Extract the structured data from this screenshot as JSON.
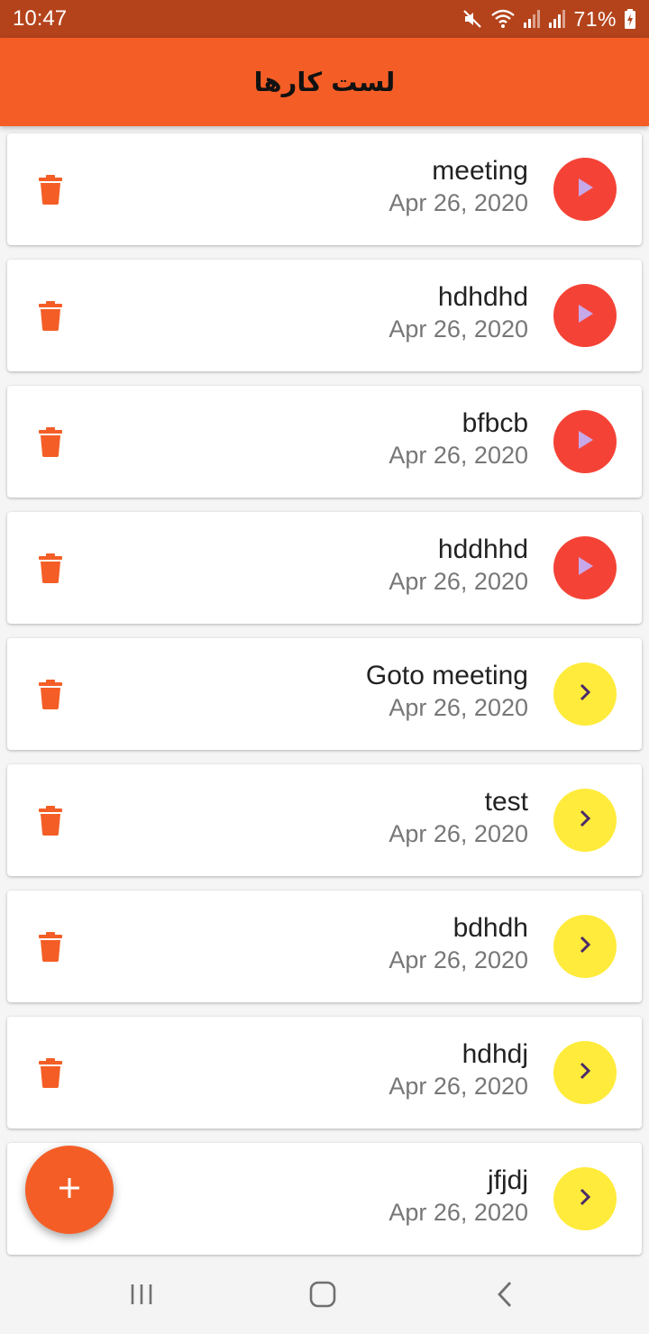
{
  "status_bar": {
    "time": "10:47",
    "battery": "71%",
    "icons": [
      "mute-icon",
      "wifi-icon",
      "signal-icon",
      "signal-icon",
      "battery-charging-icon"
    ]
  },
  "app_bar": {
    "title": "لست کارها"
  },
  "colors": {
    "status_bar": "#b4431b",
    "primary": "#f45e26",
    "play_button": "#f44336",
    "play_icon": "#c7a8e8",
    "next_button": "#ffeb3b",
    "next_icon": "#4a2a6a",
    "delete_icon": "#f45e26"
  },
  "tasks": [
    {
      "title": "meeting",
      "date": "Apr 26, 2020",
      "action": "play",
      "action_icon": "play-icon",
      "delete_icon": "trash-icon"
    },
    {
      "title": "hdhdhd",
      "date": "Apr 26, 2020",
      "action": "play",
      "action_icon": "play-icon",
      "delete_icon": "trash-icon"
    },
    {
      "title": "bfbcb",
      "date": "Apr 26, 2020",
      "action": "play",
      "action_icon": "play-icon",
      "delete_icon": "trash-icon"
    },
    {
      "title": "hddhhd",
      "date": "Apr 26, 2020",
      "action": "play",
      "action_icon": "play-icon",
      "delete_icon": "trash-icon"
    },
    {
      "title": "Goto meeting",
      "date": "Apr 26, 2020",
      "action": "next",
      "action_icon": "chevron-right-icon",
      "delete_icon": "trash-icon"
    },
    {
      "title": "test",
      "date": "Apr 26, 2020",
      "action": "next",
      "action_icon": "chevron-right-icon",
      "delete_icon": "trash-icon"
    },
    {
      "title": "bdhdh",
      "date": "Apr 26, 2020",
      "action": "next",
      "action_icon": "chevron-right-icon",
      "delete_icon": "trash-icon"
    },
    {
      "title": "hdhdj",
      "date": "Apr 26, 2020",
      "action": "next",
      "action_icon": "chevron-right-icon",
      "delete_icon": "trash-icon"
    },
    {
      "title": "jfjdj",
      "date": "Apr 26, 2020",
      "action": "next",
      "action_icon": "chevron-right-icon",
      "delete_icon": "trash-icon"
    }
  ],
  "fab": {
    "icon": "plus-icon"
  },
  "nav_bar": {
    "icons": [
      "recent-apps-icon",
      "home-icon",
      "back-icon"
    ]
  }
}
